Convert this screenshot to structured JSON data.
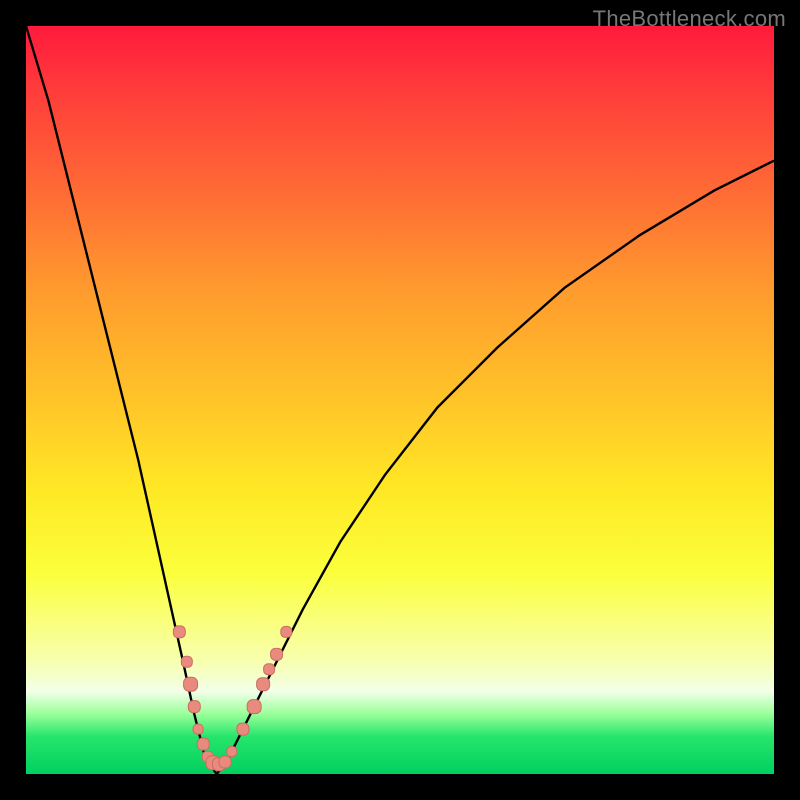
{
  "watermark": "TheBottleneck.com",
  "colors": {
    "curve": "#000000",
    "marker_fill": "#e88a7e",
    "marker_stroke": "#c96f63",
    "background_black": "#000000"
  },
  "chart_data": {
    "type": "line",
    "title": "",
    "xlabel": "",
    "ylabel": "",
    "xlim": [
      0,
      100
    ],
    "ylim": [
      0,
      100
    ],
    "grid": false,
    "legend": false,
    "series": [
      {
        "name": "bottleneck_curve",
        "x": [
          0,
          3,
          6,
          9,
          12,
          15,
          17,
          19,
          21,
          22.5,
          24,
          25.5,
          27,
          30,
          33,
          37,
          42,
          48,
          55,
          63,
          72,
          82,
          92,
          100
        ],
        "y": [
          100,
          90,
          78,
          66,
          54,
          42,
          33,
          24,
          15,
          8,
          2,
          0,
          2,
          8,
          14,
          22,
          31,
          40,
          49,
          57,
          65,
          72,
          78,
          82
        ]
      }
    ],
    "markers": [
      {
        "name": "highlighted_points",
        "points": [
          {
            "x": 20.5,
            "y": 19,
            "size": 12
          },
          {
            "x": 21.5,
            "y": 15,
            "size": 11
          },
          {
            "x": 22.0,
            "y": 12,
            "size": 14
          },
          {
            "x": 22.5,
            "y": 9,
            "size": 12
          },
          {
            "x": 23.0,
            "y": 6,
            "size": 10
          },
          {
            "x": 23.7,
            "y": 4,
            "size": 12
          },
          {
            "x": 24.3,
            "y": 2.3,
            "size": 11
          },
          {
            "x": 25.0,
            "y": 1.5,
            "size": 14
          },
          {
            "x": 25.8,
            "y": 1.3,
            "size": 13
          },
          {
            "x": 26.6,
            "y": 1.6,
            "size": 12
          },
          {
            "x": 27.5,
            "y": 3,
            "size": 10
          },
          {
            "x": 29.0,
            "y": 6,
            "size": 12
          },
          {
            "x": 30.5,
            "y": 9,
            "size": 14
          },
          {
            "x": 31.7,
            "y": 12,
            "size": 13
          },
          {
            "x": 32.5,
            "y": 14,
            "size": 11
          },
          {
            "x": 33.5,
            "y": 16,
            "size": 12
          },
          {
            "x": 34.8,
            "y": 19,
            "size": 11
          }
        ]
      }
    ]
  }
}
